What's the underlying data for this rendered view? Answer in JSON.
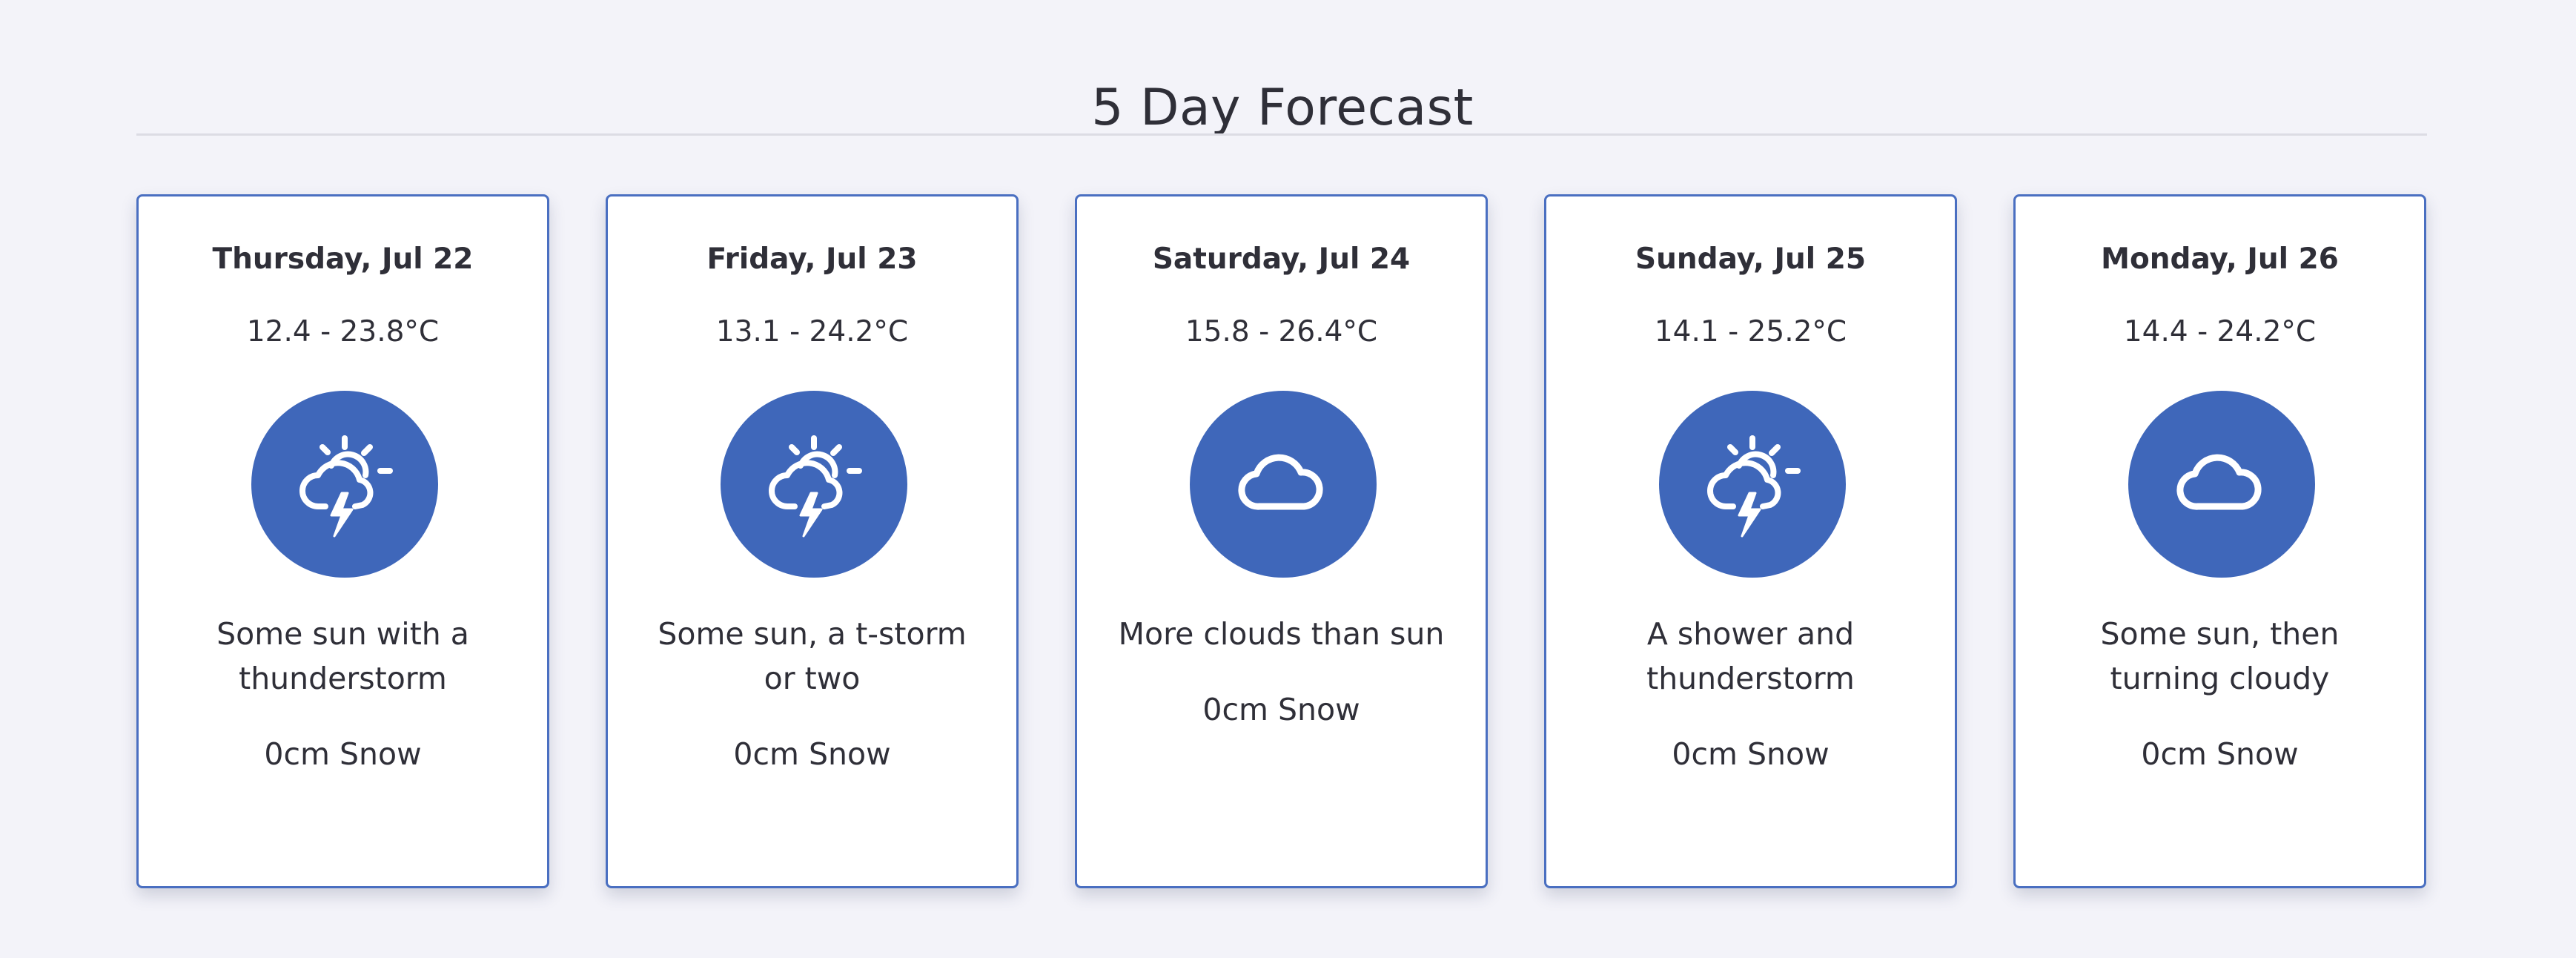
{
  "page": {
    "title": "5 Day Forecast"
  },
  "theme": {
    "accent": "#3f67ba",
    "card_border": "#4a6fc1",
    "background": "#f3f3f9"
  },
  "forecast": [
    {
      "date": "Thursday, Jul 22",
      "temp_range": "12.4 - 23.8°C",
      "icon": "thunderstorm-sun-icon",
      "description": "Some sun with a thunderstorm",
      "snow": "0cm Snow"
    },
    {
      "date": "Friday, Jul 23",
      "temp_range": "13.1 - 24.2°C",
      "icon": "thunderstorm-sun-icon",
      "description": "Some sun, a t-storm or two",
      "snow": "0cm Snow"
    },
    {
      "date": "Saturday, Jul 24",
      "temp_range": "15.8 - 26.4°C",
      "icon": "cloud-icon",
      "description": "More clouds than sun",
      "snow": "0cm Snow"
    },
    {
      "date": "Sunday, Jul 25",
      "temp_range": "14.1 - 25.2°C",
      "icon": "thunderstorm-sun-icon",
      "description": "A shower and thunderstorm",
      "snow": "0cm Snow"
    },
    {
      "date": "Monday, Jul 26",
      "temp_range": "14.4 - 24.2°C",
      "icon": "cloud-icon",
      "description": "Some sun, then turning cloudy",
      "snow": "0cm Snow"
    }
  ]
}
